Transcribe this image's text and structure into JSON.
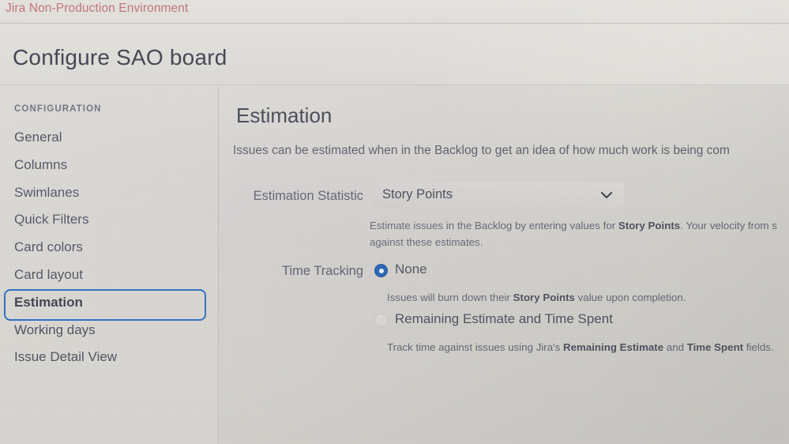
{
  "banner": {
    "text": "Jira Non-Production Environment",
    "text_color": "#c2757c"
  },
  "header": {
    "page_title": "Configure SAO board"
  },
  "sidebar": {
    "heading": "CONFIGURATION",
    "selected": "Estimation",
    "focus_ring_color": "#2a6fc4",
    "items": [
      {
        "label": "General"
      },
      {
        "label": "Columns"
      },
      {
        "label": "Swimlanes"
      },
      {
        "label": "Quick Filters"
      },
      {
        "label": "Card colors"
      },
      {
        "label": "Card layout"
      },
      {
        "label": "Estimation"
      },
      {
        "label": "Working days"
      },
      {
        "label": "Issue Detail View"
      }
    ]
  },
  "main": {
    "section_title": "Estimation",
    "section_description": "Issues can be estimated when in the Backlog to get an idea of how much work is being com",
    "estimation_statistic": {
      "label": "Estimation Statistic",
      "selected_value": "Story Points",
      "chevron_icon": "chevron-down-icon",
      "help_prefix": "Estimate issues in the Backlog by entering values for ",
      "help_bold": "Story Points",
      "help_suffix": ". Your velocity from s",
      "help_line2": "against these estimates."
    },
    "time_tracking": {
      "label": "Time Tracking",
      "selected": "None",
      "options": [
        {
          "label": "None",
          "checked": true,
          "help_prefix": "Issues will burn down their ",
          "help_bold": "Story Points",
          "help_suffix": " value upon completion."
        },
        {
          "label": "Remaining Estimate and Time Spent",
          "checked": false,
          "help_prefix": "Track time against issues using Jira's ",
          "help_bold": "Remaining Estimate",
          "help_mid": " and ",
          "help_bold2": "Time Spent",
          "help_suffix": " fields."
        }
      ]
    }
  }
}
